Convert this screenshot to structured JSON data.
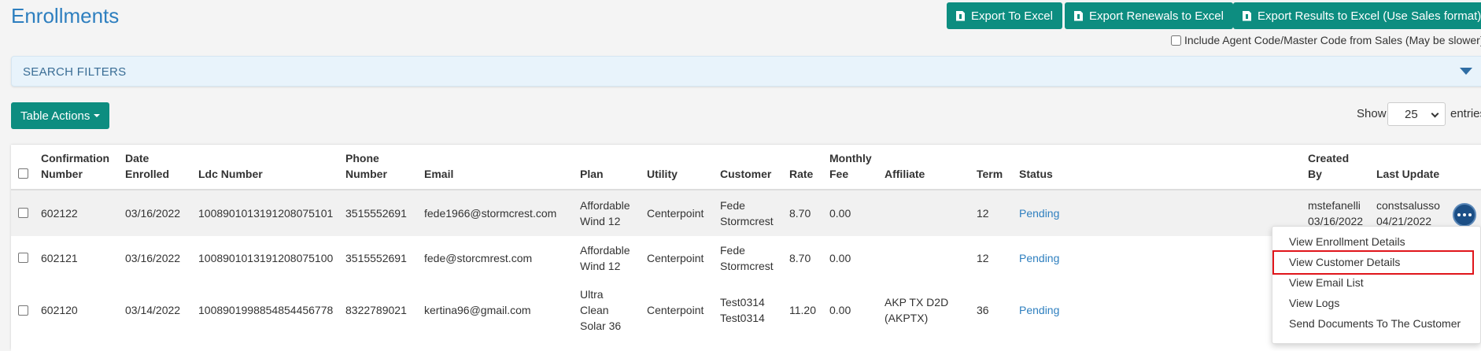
{
  "page": {
    "title": "Enrollments"
  },
  "toolbar": {
    "export_excel": "Export To Excel",
    "export_renewals": "Export Renewals to Excel",
    "export_results": "Export Results to Excel (Use Sales format)",
    "agent_code_label": "Include Agent Code/Master Code from Sales (May be slower)"
  },
  "filters": {
    "label": "SEARCH FILTERS"
  },
  "table_controls": {
    "table_actions": "Table Actions",
    "show_label": "Show",
    "page_size": "25",
    "entries_label": "entries"
  },
  "table": {
    "headers": {
      "confirmation_1": "Confirmation",
      "confirmation_2": "Number",
      "date_1": "Date",
      "date_2": "Enrolled",
      "ldc": "Ldc Number",
      "phone_1": "Phone",
      "phone_2": "Number",
      "email": "Email",
      "plan": "Plan",
      "utility": "Utility",
      "customer": "Customer",
      "rate": "Rate",
      "fee_1": "Monthly",
      "fee_2": "Fee",
      "affiliate": "Affiliate",
      "term": "Term",
      "status": "Status",
      "created_1": "Created",
      "created_2": "By",
      "last_update": "Last Update"
    },
    "rows": [
      {
        "confirmation": "602122",
        "date": "03/16/2022",
        "ldc": "1008901013191208075101",
        "phone": "3515552691",
        "email": "fede1966@stormcrest.com",
        "plan_1": "Affordable",
        "plan_2": "Wind 12",
        "plan_3": "",
        "utility": "Centerpoint",
        "customer_1": "Fede",
        "customer_2": "Stormcrest",
        "rate": "8.70",
        "fee": "0.00",
        "affiliate_1": "",
        "affiliate_2": "",
        "term": "12",
        "status": "Pending",
        "created_by": "mstefanelli",
        "created_date": "03/16/2022",
        "updated_by": "constsalusso",
        "updated_date": "04/21/2022"
      },
      {
        "confirmation": "602121",
        "date": "03/16/2022",
        "ldc": "1008901013191208075100",
        "phone": "3515552691",
        "email": "fede@storcmrest.com",
        "plan_1": "Affordable",
        "plan_2": "Wind 12",
        "plan_3": "",
        "utility": "Centerpoint",
        "customer_1": "Fede",
        "customer_2": "Stormcrest",
        "rate": "8.70",
        "fee": "0.00",
        "affiliate_1": "",
        "affiliate_2": "",
        "term": "12",
        "status": "Pending"
      },
      {
        "confirmation": "602120",
        "date": "03/14/2022",
        "ldc": "1008901998854854456778",
        "phone": "8322789021",
        "email": "kertina96@gmail.com",
        "plan_1": "Ultra",
        "plan_2": "Clean",
        "plan_3": "Solar 36",
        "utility": "Centerpoint",
        "customer_1": "Test0314",
        "customer_2": "Test0314",
        "rate": "11.20",
        "fee": "0.00",
        "affiliate_1": "AKP TX D2D",
        "affiliate_2": "(AKPTX)",
        "term": "36",
        "status": "Pending"
      }
    ]
  },
  "row_menu": {
    "items": [
      "View Enrollment Details",
      "View Customer Details",
      "View Email List",
      "View Logs",
      "Send Documents To The Customer"
    ],
    "highlighted_index": 1,
    "highlight_color": "#e0151b"
  },
  "colors": {
    "accent": "#0d8d80",
    "link": "#2e7fbf",
    "title": "#2e7fbf"
  }
}
